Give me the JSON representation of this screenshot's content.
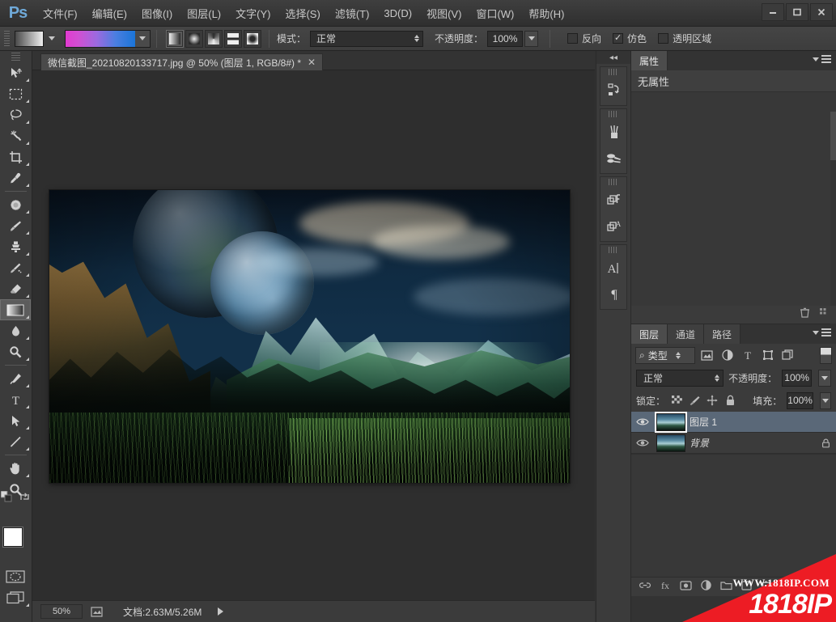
{
  "app": {
    "logo": "Ps",
    "menus": [
      {
        "label": "文件(F)",
        "name": "menu-file"
      },
      {
        "label": "编辑(E)",
        "name": "menu-edit"
      },
      {
        "label": "图像(I)",
        "name": "menu-image"
      },
      {
        "label": "图层(L)",
        "name": "menu-layer"
      },
      {
        "label": "文字(Y)",
        "name": "menu-type"
      },
      {
        "label": "选择(S)",
        "name": "menu-select"
      },
      {
        "label": "滤镜(T)",
        "name": "menu-filter"
      },
      {
        "label": "3D(D)",
        "name": "menu-3d"
      },
      {
        "label": "视图(V)",
        "name": "menu-view"
      },
      {
        "label": "窗口(W)",
        "name": "menu-window"
      },
      {
        "label": "帮助(H)",
        "name": "menu-help"
      }
    ],
    "window_buttons": {
      "minimize": "—",
      "maximize": "❐",
      "close": "✕"
    }
  },
  "options_bar": {
    "gradient_preset_name": "gradient-preset-swatch",
    "gradient_colors": [
      "#e23ad0",
      "#1a75d8"
    ],
    "gradient_types": [
      "linear",
      "radial",
      "angle",
      "reflected",
      "diamond"
    ],
    "gradient_type_active": "linear",
    "mode_label": "模式：",
    "mode_value": "正常",
    "opacity_label": "不透明度：",
    "opacity_value": "100%",
    "checkboxes": [
      {
        "label": "反向",
        "checked": false,
        "name": "reverse-checkbox"
      },
      {
        "label": "仿色",
        "checked": true,
        "name": "dither-checkbox"
      },
      {
        "label": "透明区域",
        "checked": false,
        "name": "transparency-checkbox"
      }
    ],
    "checkmark": "✓"
  },
  "toolbar": {
    "tools": [
      {
        "name": "move-tool",
        "icon": "move"
      },
      {
        "name": "rectangular-marquee-tool",
        "icon": "marquee"
      },
      {
        "name": "lasso-tool",
        "icon": "lasso"
      },
      {
        "name": "magic-wand-tool",
        "icon": "wand"
      },
      {
        "name": "crop-tool",
        "icon": "crop"
      },
      {
        "name": "eyedropper-tool",
        "icon": "eyedropper"
      },
      {
        "name": "spot-healing-brush-tool",
        "icon": "healing"
      },
      {
        "name": "brush-tool",
        "icon": "brush"
      },
      {
        "name": "clone-stamp-tool",
        "icon": "stamp"
      },
      {
        "name": "history-brush-tool",
        "icon": "history-brush"
      },
      {
        "name": "eraser-tool",
        "icon": "eraser"
      },
      {
        "name": "gradient-tool",
        "icon": "gradient",
        "active": true
      },
      {
        "name": "blur-tool",
        "icon": "blur"
      },
      {
        "name": "dodge-tool",
        "icon": "dodge"
      },
      {
        "name": "pen-tool",
        "icon": "pen"
      },
      {
        "name": "horizontal-type-tool",
        "icon": "type",
        "glyph": "T"
      },
      {
        "name": "path-selection-tool",
        "icon": "path-arrow"
      },
      {
        "name": "line-tool",
        "icon": "line"
      },
      {
        "name": "hand-tool",
        "icon": "hand"
      },
      {
        "name": "zoom-tool",
        "icon": "zoom"
      }
    ],
    "foreground_color": "#ffffff",
    "background_color": "#000000",
    "quick_mask_name": "quick-mask-toggle",
    "screen_mode_name": "screen-mode-toggle"
  },
  "document": {
    "tab_title": "微信截图_20210820133717.jpg @ 50% (图层 1, RGB/8#) *",
    "tab_close": "✕"
  },
  "status_bar": {
    "zoom": "50%",
    "doc_info": "文档:2.63M/5.26M"
  },
  "dock": {
    "collapse_glyph": "◂◂",
    "groups": [
      {
        "icons": [
          {
            "name": "history-panel-icon",
            "glyph": "history"
          }
        ]
      },
      {
        "icons": [
          {
            "name": "brush-presets-panel-icon",
            "glyph": "brushes"
          },
          {
            "name": "tool-presets-panel-icon",
            "glyph": "tool-presets"
          }
        ]
      },
      {
        "icons": [
          {
            "name": "character-styles-panel-icon",
            "glyph": "char-styles"
          },
          {
            "name": "paragraph-styles-panel-icon",
            "glyph": "para-styles"
          }
        ]
      },
      {
        "icons": [
          {
            "name": "character-panel-icon",
            "glyph": "A|"
          },
          {
            "name": "paragraph-panel-icon",
            "glyph": "¶"
          }
        ]
      }
    ]
  },
  "properties_panel": {
    "tab_label": "属性",
    "empty_text": "无属性",
    "footer_icons": [
      {
        "name": "delete-properties-icon",
        "glyph": "trash"
      },
      {
        "name": "properties-options-icon",
        "glyph": "grid"
      }
    ]
  },
  "layers_panel": {
    "tabs": [
      {
        "label": "图层",
        "name": "tab-layers",
        "active": true
      },
      {
        "label": "通道",
        "name": "tab-channels",
        "active": false
      },
      {
        "label": "路径",
        "name": "tab-paths",
        "active": false
      }
    ],
    "filter": {
      "search_glyph": "⌕",
      "type_label": "类型",
      "filter_icons": [
        {
          "name": "filter-pixel-icon"
        },
        {
          "name": "filter-adjustment-icon"
        },
        {
          "name": "filter-type-icon",
          "glyph": "T"
        },
        {
          "name": "filter-shape-icon"
        },
        {
          "name": "filter-smart-object-icon"
        }
      ]
    },
    "blend_mode_label": "",
    "blend_mode_value": "正常",
    "opacity_label": "不透明度：",
    "opacity_value": "100%",
    "lock_label": "锁定：",
    "lock_icons": [
      {
        "name": "lock-transparent-pixels-icon"
      },
      {
        "name": "lock-image-pixels-icon"
      },
      {
        "name": "lock-position-icon"
      },
      {
        "name": "lock-all-icon"
      }
    ],
    "fill_label": "填充：",
    "fill_value": "100%",
    "layers": [
      {
        "name_text": "图层 1",
        "selected": true,
        "visible": true,
        "locked": false,
        "eye": "👁"
      },
      {
        "name_text": "背景",
        "selected": false,
        "visible": true,
        "locked": true,
        "eye": "👁"
      }
    ],
    "footer_icons": [
      {
        "name": "link-layers-icon"
      },
      {
        "name": "layer-style-icon"
      },
      {
        "name": "add-layer-mask-icon"
      },
      {
        "name": "new-adjustment-layer-icon"
      },
      {
        "name": "new-group-icon"
      },
      {
        "name": "new-layer-icon"
      },
      {
        "name": "delete-layer-icon"
      }
    ]
  },
  "watermark": {
    "url": "WWW.1818IP.COM",
    "brand": "1818IP",
    "color": "#ed1c24"
  },
  "canvas": {
    "artwork_name": "fantasy-landscape-planets-mountains"
  }
}
